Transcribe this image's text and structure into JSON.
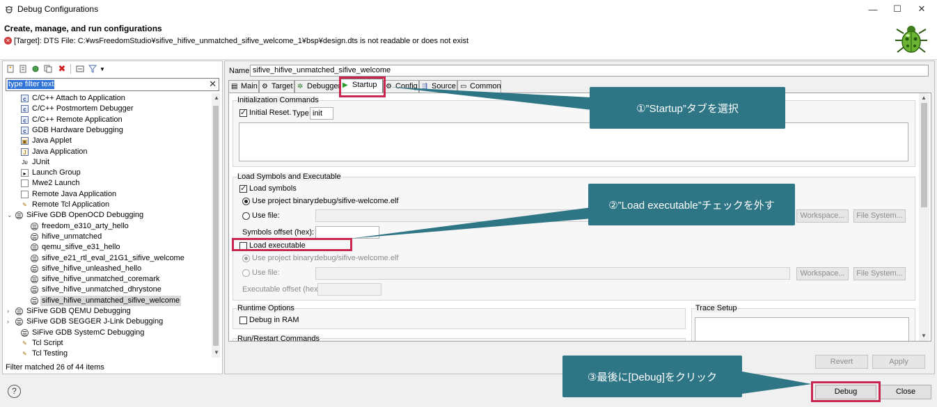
{
  "window": {
    "title": "Debug Configurations",
    "minimize": "—",
    "maximize": "☐",
    "close": "✕"
  },
  "header": {
    "title": "Create, manage, and run configurations",
    "message": "[Target]: DTS File: C:¥wsFreedomStudio¥sifive_hifive_unmatched_sifive_welcome_1¥bsp¥design.dts is not readable or does not exist"
  },
  "left": {
    "filter_placeholder": "type filter text",
    "filter_status": "Filter matched 26 of 44 items",
    "tree": [
      {
        "label": "C/C++ Attach to Application",
        "icon": "c-icon",
        "level": 1
      },
      {
        "label": "C/C++ Postmortem Debugger",
        "icon": "c-icon",
        "level": 1
      },
      {
        "label": "C/C++ Remote Application",
        "icon": "c-icon",
        "level": 1
      },
      {
        "label": "GDB Hardware Debugging",
        "icon": "c-icon",
        "level": 1
      },
      {
        "label": "Java Applet",
        "icon": "applet-icon",
        "level": 1
      },
      {
        "label": "Java Application",
        "icon": "java-icon",
        "level": 1
      },
      {
        "label": "JUnit",
        "icon": "junit-icon",
        "level": 1
      },
      {
        "label": "Launch Group",
        "icon": "launch-group-icon",
        "level": 1
      },
      {
        "label": "Mwe2 Launch",
        "icon": "doc-icon",
        "level": 1
      },
      {
        "label": "Remote Java Application",
        "icon": "doc-icon",
        "level": 1
      },
      {
        "label": "Remote Tcl Application",
        "icon": "tool-icon",
        "level": 1
      },
      {
        "label": "SiFive GDB OpenOCD Debugging",
        "icon": "bug-icon",
        "level": 0,
        "expanded": true
      },
      {
        "label": "freedom_e310_arty_hello",
        "icon": "bug-icon",
        "level": 2
      },
      {
        "label": "hifive_unmatched",
        "icon": "bug-icon",
        "level": 2
      },
      {
        "label": "qemu_sifive_e31_hello",
        "icon": "bug-icon",
        "level": 2
      },
      {
        "label": "sifive_e21_rtl_eval_21G1_sifive_welcome",
        "icon": "bug-icon",
        "level": 2
      },
      {
        "label": "sifive_hifive_unleashed_hello",
        "icon": "bug-icon",
        "level": 2
      },
      {
        "label": "sifive_hifive_unmatched_coremark",
        "icon": "bug-icon",
        "level": 2
      },
      {
        "label": "sifive_hifive_unmatched_dhrystone",
        "icon": "bug-icon",
        "level": 2
      },
      {
        "label": "sifive_hifive_unmatched_sifive_welcome",
        "icon": "bug-icon",
        "level": 2,
        "selected": true
      },
      {
        "label": "SiFive GDB QEMU Debugging",
        "icon": "bug-icon",
        "level": 0,
        "expanded": false
      },
      {
        "label": "SiFive GDB SEGGER J-Link Debugging",
        "icon": "bug-icon",
        "level": 0,
        "expanded": false
      },
      {
        "label": "SiFive GDB SystemC Debugging",
        "icon": "bug-icon",
        "level": 1
      },
      {
        "label": "Tcl Script",
        "icon": "tool-icon",
        "level": 1
      },
      {
        "label": "Tcl Testing",
        "icon": "tool-icon",
        "level": 1
      }
    ]
  },
  "right": {
    "name_label": "Name:",
    "name_value": "sifive_hifive_unmatched_sifive_welcome",
    "tabs": [
      "Main",
      "Target",
      "Debugger",
      "Startup",
      "Config",
      "Source",
      "Common"
    ],
    "active_tab": "Startup",
    "init": {
      "group_label": "Initialization Commands",
      "initial_reset": "Initial Reset.",
      "type_label": "Type:",
      "type_value": "init"
    },
    "load": {
      "group_label": "Load Symbols and Executable",
      "load_symbols": "Load symbols",
      "use_project_binary": "Use project binary:",
      "binary_path": "debug/sifive-welcome.elf",
      "use_file": "Use file:",
      "workspace": "Workspace...",
      "file_system": "File System...",
      "symbols_offset": "Symbols offset (hex):",
      "load_executable": "Load executable",
      "exe_use_project_binary": "Use project binary:",
      "exe_binary_path": "debug/sifive-welcome.elf",
      "exe_use_file": "Use file:",
      "exe_offset": "Executable offset (hex):"
    },
    "runtime": {
      "group_label": "Runtime Options",
      "debug_in_ram": "Debug in RAM"
    },
    "trace_label": "Trace Setup",
    "run_restart_label": "Run/Restart Commands",
    "revert": "Revert",
    "apply": "Apply"
  },
  "footer": {
    "help": "?",
    "debug": "Debug",
    "close": "Close"
  },
  "annotations": {
    "step1": "①”Startup”タブを選択",
    "step2": "②”Load executable”チェックを外す",
    "step3": "③最後に[Debug]をクリック"
  },
  "colors": {
    "callout": "#2e7585",
    "highlight": "#c8264f",
    "selection": "#3074d8"
  }
}
